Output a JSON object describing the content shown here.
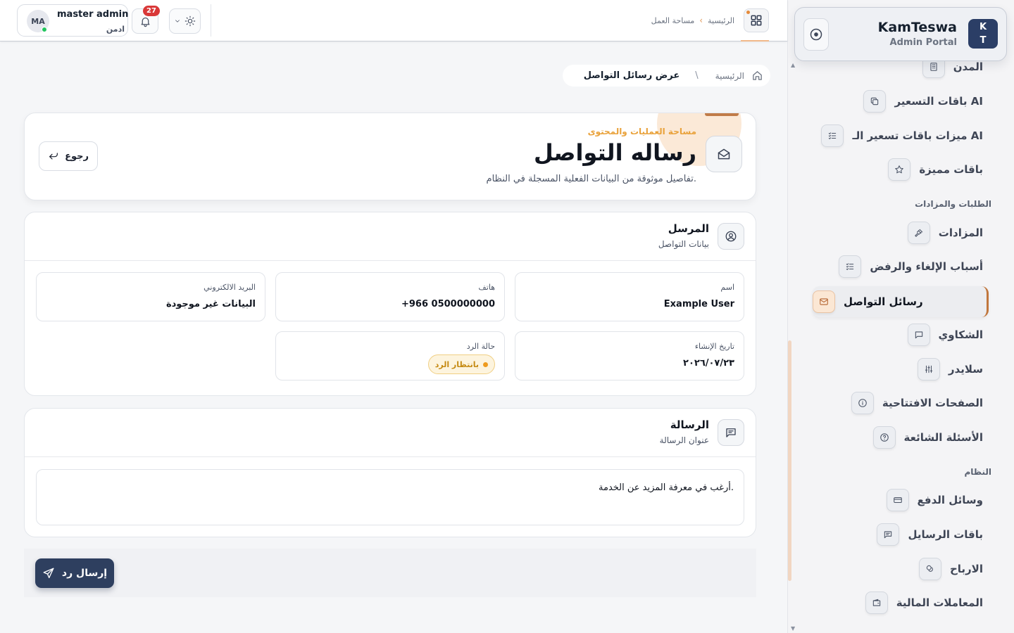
{
  "brand": {
    "logo_line1": "K",
    "logo_line2": "T",
    "name": "KamTeswa",
    "subtitle": "Admin Portal"
  },
  "sidebar": {
    "items": [
      {
        "label": "المدن",
        "icon": "building-icon"
      },
      {
        "label": "باقات التسعير AI",
        "icon": "copy-icon"
      },
      {
        "label": "ميزات باقات تسعير الـ AI",
        "icon": "list-check-icon"
      },
      {
        "label": "باقات مميزة",
        "icon": "star-icon"
      },
      {
        "label": "المزادات",
        "icon": "gavel-icon"
      },
      {
        "label": "أسباب الإلغاء والرفض",
        "icon": "list-check-icon"
      },
      {
        "label": "رسائل التواصل",
        "icon": "mail-icon",
        "active": true
      },
      {
        "label": "الشكاوي",
        "icon": "message-square-icon"
      },
      {
        "label": "سلايدر",
        "icon": "sliders-icon"
      },
      {
        "label": "الصفحات الافتتاحية",
        "icon": "info-icon"
      },
      {
        "label": "الأسئلة الشائعة",
        "icon": "help-icon"
      },
      {
        "label": "وسائل الدفع",
        "icon": "credit-card-icon"
      },
      {
        "label": "باقات الرسايل",
        "icon": "message-square-icon"
      },
      {
        "label": "الارباح",
        "icon": "coins-icon"
      },
      {
        "label": "المعاملات المالية",
        "icon": "wallet-icon"
      }
    ],
    "sections": {
      "requests": "الطلبات والمزادات",
      "system": "النظام"
    }
  },
  "topbar": {
    "breadcrumb_home": "الرئيسية",
    "breadcrumb_current": "مساحة العمل",
    "notifications_count": "27",
    "user_initials": "MA",
    "user_name": "master admin",
    "user_role": "ادمن"
  },
  "page_breadcrumb": {
    "home": "الرئيسية",
    "separator": "\\",
    "current": "عرض رسائل التواصل"
  },
  "hero": {
    "eyebrow": "مساحة العمليات والمحتوى",
    "title": "رساله التواصل",
    "subtitle": "تفاصيل موثوقة من البيانات الفعلية المسجلة في النظام.",
    "back_label": "رجوع"
  },
  "sender": {
    "title": "المرسل",
    "subtitle": "بيانات التواصل",
    "fields": {
      "name_label": "اسم",
      "name_value": "Example User",
      "phone_label": "هاتف",
      "phone_value": "+966 0500000000",
      "email_label": "البريد الالكتروني",
      "email_value": "البيانات غير موجودة",
      "created_label": "تاريخ الإنشاء",
      "created_value": "٢٠٢٦/٠٧/٢٣",
      "status_label": "حالة الرد",
      "status_value": "بانتظار الرد"
    }
  },
  "message": {
    "title": "الرسالة",
    "subtitle": "عنوان الرسالة",
    "body": "أرغب في معرفة المزيد عن الخدمة."
  },
  "actions": {
    "reply_label": "إرسال رد"
  },
  "colors": {
    "accent": "#c0763c",
    "primary_button": "#2e3f5f",
    "status_pending": "#ee9b1e",
    "eyebrow": "#e9a23b",
    "notification": "#d93838"
  }
}
